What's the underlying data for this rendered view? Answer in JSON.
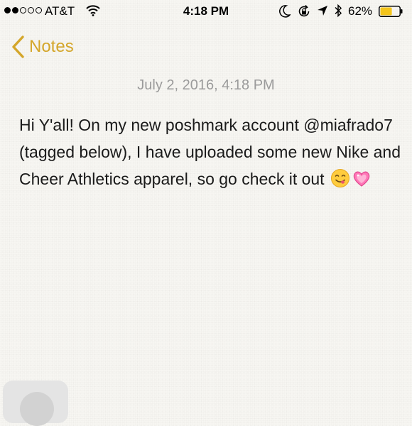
{
  "status_bar": {
    "carrier": "AT&T",
    "time": "4:18 PM",
    "battery_percent": "62%",
    "battery_level": 0.62,
    "signal_bars_filled": 2,
    "signal_bars_total": 5,
    "icons": [
      "wifi-icon",
      "moon-icon",
      "rotation-lock-icon",
      "location-arrow-icon",
      "bluetooth-icon",
      "battery-icon"
    ]
  },
  "nav": {
    "back_label": "Notes"
  },
  "note": {
    "date": "July 2, 2016, 4:18 PM",
    "text": "Hi Y'all! On my new poshmark account @miafrado7 (tagged below), I have uploaded some new Nike and Cheer Athletics apparel, so go check it out",
    "emojis": [
      "😋",
      "💗"
    ]
  },
  "colors": {
    "accent": "#d4a62a",
    "battery_fill": "#f4c51c",
    "date_text": "#9b9b9b"
  }
}
